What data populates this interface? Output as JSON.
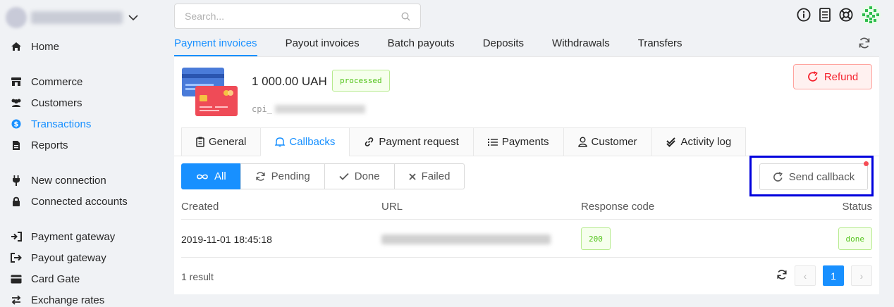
{
  "search": {
    "placeholder": "Search..."
  },
  "sidebar": {
    "items": [
      {
        "label": "Home",
        "icon": "home-icon"
      },
      {
        "label": "Commerce",
        "icon": "store-icon"
      },
      {
        "label": "Customers",
        "icon": "users-icon"
      },
      {
        "label": "Transactions",
        "icon": "dollar-icon",
        "active": true
      },
      {
        "label": "Reports",
        "icon": "file-icon"
      },
      {
        "label": "New connection",
        "icon": "plug-icon"
      },
      {
        "label": "Connected accounts",
        "icon": "lock-icon"
      },
      {
        "label": "Payment gateway",
        "icon": "sign-in-icon"
      },
      {
        "label": "Payout gateway",
        "icon": "sign-out-icon"
      },
      {
        "label": "Card Gate",
        "icon": "card-icon"
      },
      {
        "label": "Exchange rates",
        "icon": "exchange-icon"
      }
    ]
  },
  "main_tabs": [
    "Payment invoices",
    "Payout invoices",
    "Batch payouts",
    "Deposits",
    "Withdrawals",
    "Transfers"
  ],
  "invoice": {
    "amount": "1 000.00 UAH",
    "status": "processed",
    "id_prefix": "cpi_",
    "refund_label": "Refund"
  },
  "detail_tabs": [
    "General",
    "Callbacks",
    "Payment request",
    "Payments",
    "Customer",
    "Activity log"
  ],
  "filters": [
    "All",
    "Pending",
    "Done",
    "Failed"
  ],
  "send_callback_label": "Send callback",
  "table": {
    "headers": {
      "created": "Created",
      "url": "URL",
      "response_code": "Response code",
      "status": "Status"
    },
    "rows": [
      {
        "created": "2019-11-01 18:45:18",
        "response_code": "200",
        "status": "done"
      }
    ]
  },
  "result_text": "1 result",
  "pagination": {
    "current_page": "1",
    "prev": "‹",
    "next": "›"
  },
  "colors": {
    "accent": "#1890ff",
    "success": "#52c41a",
    "danger": "#f5222d",
    "highlight_frame": "#0000dd"
  }
}
